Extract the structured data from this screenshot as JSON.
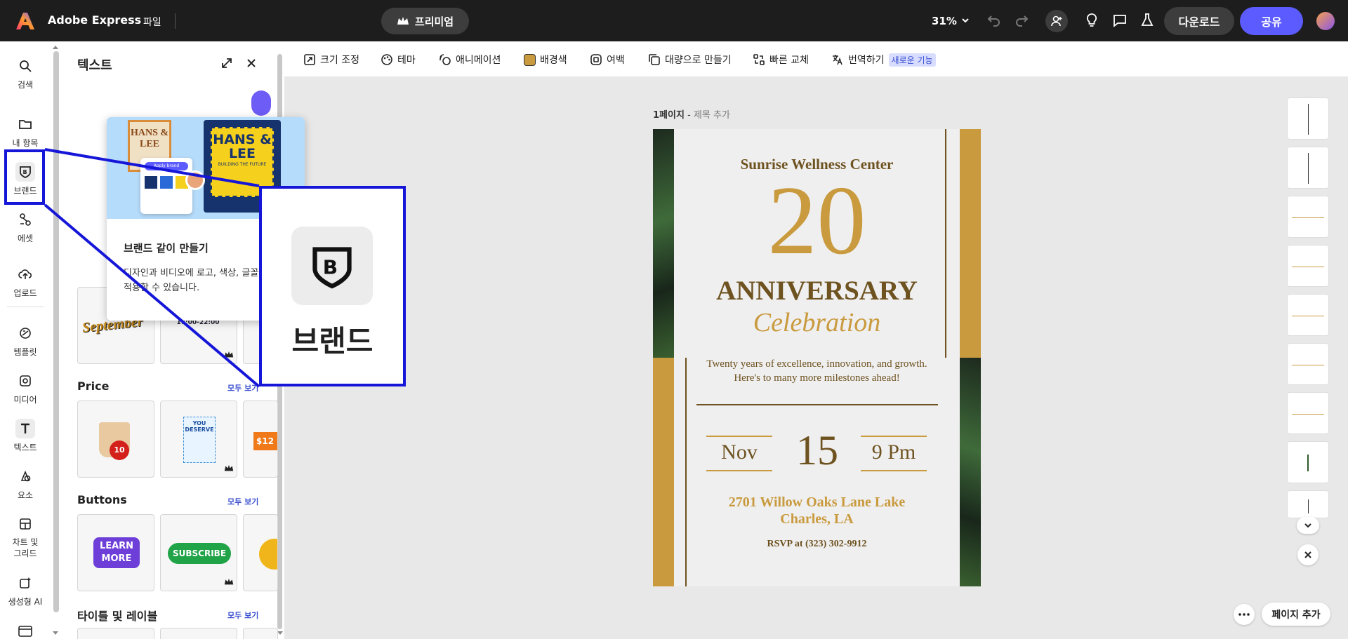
{
  "app": {
    "name": "Adobe Express",
    "file_menu": "파일",
    "premium": "프리미엄",
    "zoom": "31%",
    "download": "다운로드",
    "share": "공유"
  },
  "rail": {
    "items": [
      "검색",
      "내 항목",
      "브랜드",
      "에셋",
      "업로드",
      "템플릿",
      "미디어",
      "텍스트",
      "요소",
      "차트 및 그리드",
      "생성형 AI"
    ]
  },
  "panel": {
    "title": "텍스트",
    "popup_title": "브랜드 같이 만들기",
    "popup_desc": "디자인과 비디오에 로고, 색상, 글꼴을 쉽게 적용할 수 있습니다.",
    "popup_card_left": "HANS & LEE",
    "popup_card_right": "HANS & LEE",
    "popup_card_right_sub": "BUILDING THE FUTURE",
    "popup_apply": "Apply brand",
    "sections": [
      {
        "title": "Price",
        "see_all": "모두 보기"
      },
      {
        "title": "Buttons",
        "see_all": "모두 보기"
      },
      {
        "title": "타이틀 및 레이블",
        "see_all": "모두 보기"
      }
    ],
    "card_september": "September",
    "card_times": "11:00-15:00 17:00-22:00",
    "card_learn": "LEARN MORE",
    "card_subscribe": "SUBSCRIBE",
    "card_price_tag": "$12",
    "card_price_badge": "10",
    "card_you": "YOU DESERVE"
  },
  "zoom_label": "브랜드",
  "toolbar": {
    "items": [
      "크기 조정",
      "테마",
      "애니메이션",
      "배경색",
      "여백",
      "대량으로 만들기",
      "빠른 교체",
      "번역하기"
    ],
    "new_badge": "새로운 기능",
    "bg_color": "#c99a3e"
  },
  "page": {
    "label": "1페이지",
    "title_placeholder": "제목 추가",
    "add_page": "페이지 추가"
  },
  "poster": {
    "org": "Sunrise Wellness Center",
    "number": "20",
    "title": "ANNIVERSARY",
    "subtitle": "Celebration",
    "text": "Twenty years of excellence, innovation, and growth. Here's to many more milestones ahead!",
    "month": "Nov",
    "day": "15",
    "time": "9 Pm",
    "address": "2701 Willow Oaks Lane Lake Charles, LA",
    "rsvp": "RSVP at (323) 302-9912",
    "gold": "#c99a3e",
    "brown": "#6e5220"
  }
}
